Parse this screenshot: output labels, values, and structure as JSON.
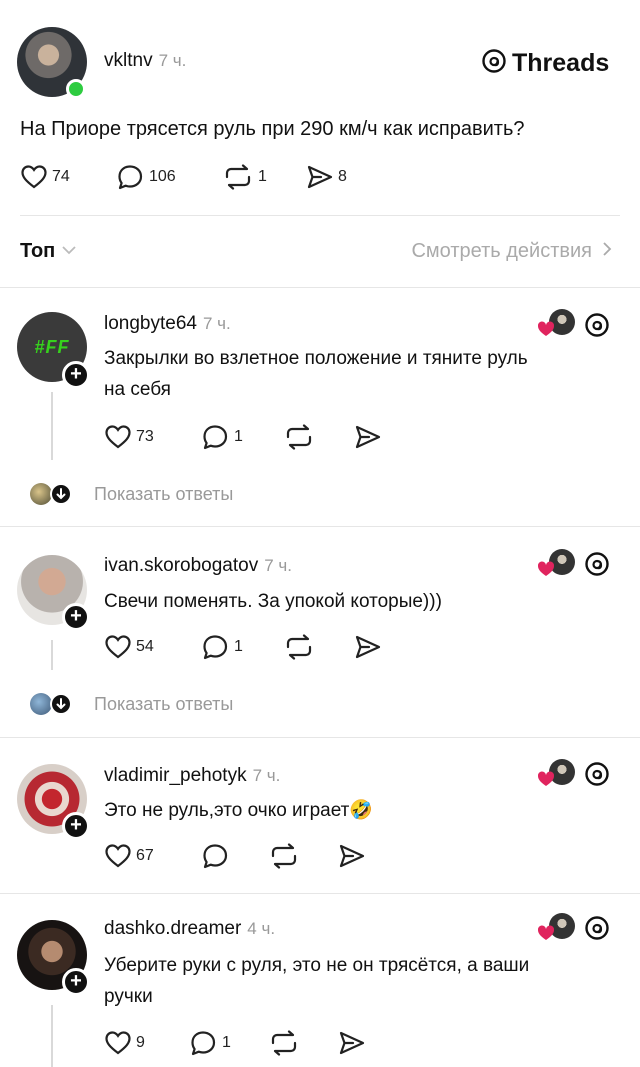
{
  "post": {
    "username": "vkltnv",
    "time": "7 ч.",
    "brand": "Threads",
    "text": "На Приоре трясется руль при 290 км/ч как исправить?",
    "likes": "74",
    "comments": "106",
    "reposts": "1",
    "shares": "8"
  },
  "filter": {
    "sort_label": "Топ",
    "activity_link": "Смотреть действия"
  },
  "replies": [
    {
      "username": "longbyte64",
      "time": "7 ч.",
      "avatar_text": "#FF",
      "text_lines": [
        "Закрылки во взлетное положение и тяните руль",
        "на себя"
      ],
      "likes": "73",
      "comments": "1",
      "show_replies": "Показать ответы"
    },
    {
      "username": "ivan.skorobogatov",
      "time": "7 ч.",
      "text_lines": [
        "Свечи поменять. За упокой которые)))"
      ],
      "likes": "54",
      "comments": "1",
      "show_replies": "Показать ответы"
    },
    {
      "username": "vladimir_pehotyk",
      "time": "7 ч.",
      "text_lines": [
        "Это не руль,это очко играет🤣"
      ],
      "likes": "67"
    },
    {
      "username": "dashko.dreamer",
      "time": "4 ч.",
      "text_lines": [
        "Уберите руки с руля, это не он трясётся, а ваши",
        "ручки"
      ],
      "likes": "9",
      "comments": "1"
    }
  ],
  "colors": {
    "online": "#2ecc40",
    "muted": "#999999",
    "like_red": "#e0245e",
    "avatar_ff_bg": "#3a3a3a",
    "avatar_ff_text": "#36d11d"
  }
}
